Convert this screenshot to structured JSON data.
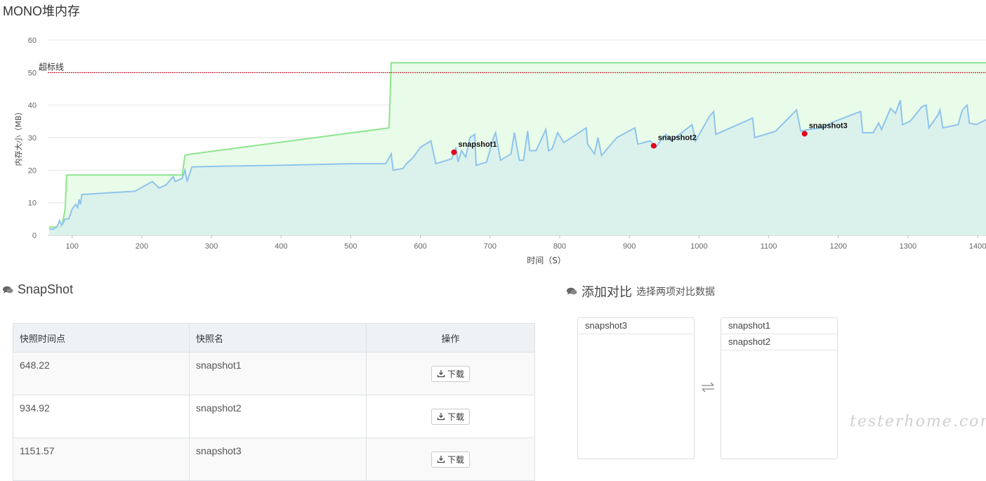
{
  "page": {
    "title": "MONO堆内存"
  },
  "chart_data": {
    "type": "line",
    "title": "",
    "xlabel": "时间（S）",
    "ylabel": "内存大小（MB）",
    "xlim": [
      65,
      1412
    ],
    "ylim": [
      0,
      60
    ],
    "x_ticks": [
      100,
      200,
      300,
      400,
      500,
      600,
      700,
      800,
      900,
      1000,
      1100,
      1200,
      1300,
      1400
    ],
    "y_ticks": [
      0,
      10,
      20,
      30,
      40,
      50,
      60
    ],
    "grid": true,
    "threshold": {
      "label": "超标线",
      "value": 50,
      "color": "#c0001a"
    },
    "series": [
      {
        "name": "",
        "color": "#8ee58e",
        "fill": "#e9fbe9",
        "points": [
          [
            67,
            2.5
          ],
          [
            85,
            2.5
          ],
          [
            90,
            8
          ],
          [
            92,
            18.5
          ],
          [
            258,
            18.5
          ],
          [
            262,
            24.6
          ],
          [
            272,
            25
          ],
          [
            555,
            33
          ],
          [
            558,
            53
          ],
          [
            1412,
            53
          ]
        ]
      },
      {
        "name": "",
        "color": "#8fc4ec",
        "fill": "#d9f1ec",
        "points": [
          [
            67,
            2
          ],
          [
            72,
            1.8
          ],
          [
            78,
            2.5
          ],
          [
            82,
            4.5
          ],
          [
            85,
            3
          ],
          [
            90,
            5
          ],
          [
            95,
            5
          ],
          [
            100,
            8
          ],
          [
            105,
            9.5
          ],
          [
            108,
            8.5
          ],
          [
            110,
            11
          ],
          [
            112,
            9.5
          ],
          [
            114,
            12.5
          ],
          [
            150,
            13
          ],
          [
            190,
            13.5
          ],
          [
            215,
            16.5
          ],
          [
            225,
            14.5
          ],
          [
            235,
            15.5
          ],
          [
            245,
            18
          ],
          [
            248,
            16.5
          ],
          [
            258,
            17.5
          ],
          [
            262,
            20
          ],
          [
            265,
            16.5
          ],
          [
            272,
            21
          ],
          [
            310,
            21.2
          ],
          [
            400,
            21.5
          ],
          [
            500,
            22
          ],
          [
            550,
            22
          ],
          [
            553,
            23
          ],
          [
            558,
            25
          ],
          [
            561,
            20
          ],
          [
            575,
            20.5
          ],
          [
            580,
            22
          ],
          [
            590,
            24
          ],
          [
            600,
            27
          ],
          [
            615,
            29
          ],
          [
            622,
            22
          ],
          [
            645,
            23.5
          ],
          [
            651,
            27
          ],
          [
            654,
            22.5
          ],
          [
            659,
            26
          ],
          [
            665,
            24
          ],
          [
            671,
            30
          ],
          [
            678,
            31
          ],
          [
            680,
            21.5
          ],
          [
            695,
            22.5
          ],
          [
            705,
            30
          ],
          [
            708,
            31.5
          ],
          [
            715,
            23
          ],
          [
            730,
            25
          ],
          [
            735,
            31.5
          ],
          [
            742,
            23
          ],
          [
            748,
            23
          ],
          [
            754,
            32
          ],
          [
            757,
            26
          ],
          [
            766,
            26
          ],
          [
            780,
            32.5
          ],
          [
            784,
            26
          ],
          [
            789,
            26.5
          ],
          [
            797,
            31.5
          ],
          [
            806,
            28.5
          ],
          [
            838,
            33
          ],
          [
            840,
            28
          ],
          [
            850,
            25
          ],
          [
            855,
            30
          ],
          [
            860,
            24.5
          ],
          [
            870,
            27
          ],
          [
            882,
            30
          ],
          [
            908,
            33
          ],
          [
            912,
            28
          ],
          [
            930,
            29
          ],
          [
            938,
            27
          ],
          [
            946,
            29.5
          ],
          [
            953,
            31
          ],
          [
            960,
            29
          ],
          [
            990,
            34
          ],
          [
            995,
            29
          ],
          [
            1015,
            36.5
          ],
          [
            1021,
            38
          ],
          [
            1024,
            31
          ],
          [
            1040,
            32.5
          ],
          [
            1061,
            34.5
          ],
          [
            1077,
            36
          ],
          [
            1080,
            30
          ],
          [
            1110,
            32
          ],
          [
            1140,
            38.5
          ],
          [
            1146,
            32
          ],
          [
            1158,
            32.5
          ],
          [
            1175,
            33
          ],
          [
            1195,
            35
          ],
          [
            1225,
            37.5
          ],
          [
            1232,
            38
          ],
          [
            1235,
            31.5
          ],
          [
            1250,
            31.5
          ],
          [
            1258,
            34.5
          ],
          [
            1262,
            32.5
          ],
          [
            1275,
            39
          ],
          [
            1282,
            37.5
          ],
          [
            1289,
            41.5
          ],
          [
            1292,
            34
          ],
          [
            1303,
            35
          ],
          [
            1320,
            39.5
          ],
          [
            1326,
            40
          ],
          [
            1330,
            33
          ],
          [
            1343,
            37
          ],
          [
            1346,
            38.5
          ],
          [
            1350,
            33
          ],
          [
            1372,
            34
          ],
          [
            1378,
            38.5
          ],
          [
            1385,
            40
          ],
          [
            1388,
            34.5
          ],
          [
            1398,
            34
          ],
          [
            1412,
            35.5
          ]
        ]
      }
    ],
    "markers": [
      {
        "label": "snapshot1",
        "x": 648.22,
        "y": 25.5,
        "color": "#e2001a"
      },
      {
        "label": "snapshot2",
        "x": 934.92,
        "y": 27.5,
        "color": "#e2001a"
      },
      {
        "label": "snapshot3",
        "x": 1151.57,
        "y": 31.2,
        "color": "#e2001a"
      }
    ]
  },
  "snapshot_section": {
    "title": "SnapShot",
    "columns": [
      "快照时间点",
      "快照名",
      "操作"
    ],
    "rows": [
      {
        "time": "648.22",
        "name": "snapshot1",
        "action": "下载"
      },
      {
        "time": "934.92",
        "name": "snapshot2",
        "action": "下载"
      },
      {
        "time": "1151.57",
        "name": "snapshot3",
        "action": "下载"
      }
    ]
  },
  "compare_section": {
    "title": "添加对比",
    "subtitle": "选择两项对比数据",
    "left_list": [
      "snapshot3"
    ],
    "right_list": [
      "snapshot1",
      "snapshot2"
    ]
  },
  "watermark": "testerhome.com"
}
